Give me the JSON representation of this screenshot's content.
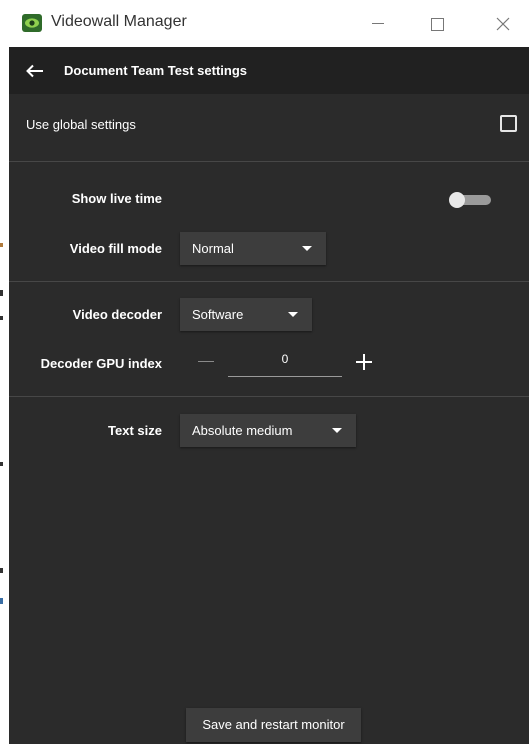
{
  "window": {
    "title": "Videowall Manager",
    "controls": {
      "minimize_icon": "minimize-icon",
      "maximize_icon": "maximize-icon",
      "close_icon": "close-icon"
    }
  },
  "header": {
    "back_icon": "arrow-left-icon",
    "title": "Document Team Test settings"
  },
  "global": {
    "label": "Use global settings",
    "checked": false
  },
  "settings": {
    "show_live_time": {
      "label": "Show live time",
      "enabled": false
    },
    "video_fill_mode": {
      "label": "Video fill mode",
      "value": "Normal"
    },
    "video_decoder": {
      "label": "Video decoder",
      "value": "Software"
    },
    "decoder_gpu_index": {
      "label": "Decoder GPU index",
      "value": "0"
    },
    "text_size": {
      "label": "Text size",
      "value": "Absolute medium"
    }
  },
  "footer": {
    "save_label": "Save and restart monitor"
  },
  "colors": {
    "background": "#2b2b2b",
    "header": "#212121",
    "control": "#3d3d3d",
    "text": "#ffffff",
    "app_icon": "#2f6b2a"
  }
}
